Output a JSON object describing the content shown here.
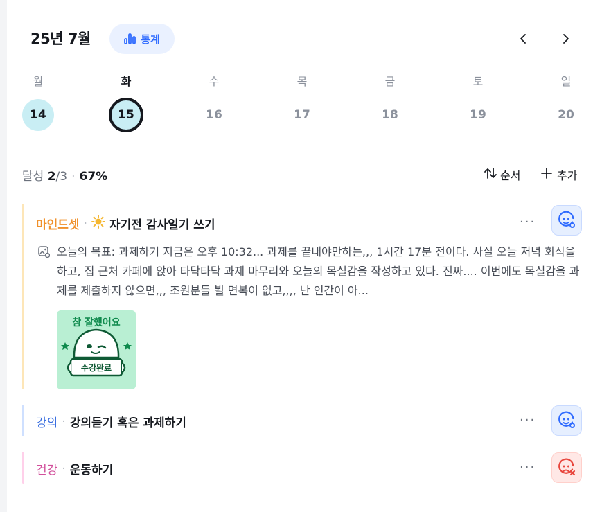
{
  "header": {
    "month_title": "25년 7월",
    "stats_label": "통계"
  },
  "week": {
    "days": [
      {
        "name": "월",
        "num": "14",
        "state": "done"
      },
      {
        "name": "화",
        "num": "15",
        "state": "selected"
      },
      {
        "name": "수",
        "num": "16",
        "state": "none"
      },
      {
        "name": "목",
        "num": "17",
        "state": "none"
      },
      {
        "name": "금",
        "num": "18",
        "state": "none"
      },
      {
        "name": "토",
        "num": "19",
        "state": "none"
      },
      {
        "name": "일",
        "num": "20",
        "state": "none"
      }
    ]
  },
  "summary": {
    "label": "달성",
    "done": "2",
    "total": "/3",
    "percent": "67%",
    "sort_label": "순서",
    "add_label": "추가"
  },
  "goals": [
    {
      "category": "마인드셋",
      "category_color": "#f0902a",
      "emoji": "☀️",
      "title": "자기전 감사일기 쓰기",
      "status": "ok",
      "note": "오늘의 목표: 과제하기 지금은 오후 10:32... 과제를 끝내야만하는,,, 1시간 17분 전이다. 사실 오늘 저녁 회식을 하고, 집 근처 카페에 앉아 타닥타닥 과제 마무리와 오늘의 목실감을 작성하고 있다. 진짜.... 이번에도 목실감을 과제를 제출하지 않으면,,, 조원분들 뵐 면복이 없고,,,, 난 인간이 아...",
      "sticker_top": "참 잘했어요",
      "sticker_bottom": "수강완료"
    },
    {
      "category": "강의",
      "category_color": "#3b6fe0",
      "title": "강의듣기 혹은 과제하기",
      "status": "ok"
    },
    {
      "category": "건강",
      "category_color": "#d2509c",
      "title": "운동하기",
      "status": "bad"
    }
  ],
  "colors": {
    "accent_blue": "#2f6bff",
    "done_day_bg": "#c9eef4",
    "goal1_bar": "#fde6b8",
    "goal2_bar": "#cfe0ff",
    "goal3_bar": "#ffd0ea"
  }
}
